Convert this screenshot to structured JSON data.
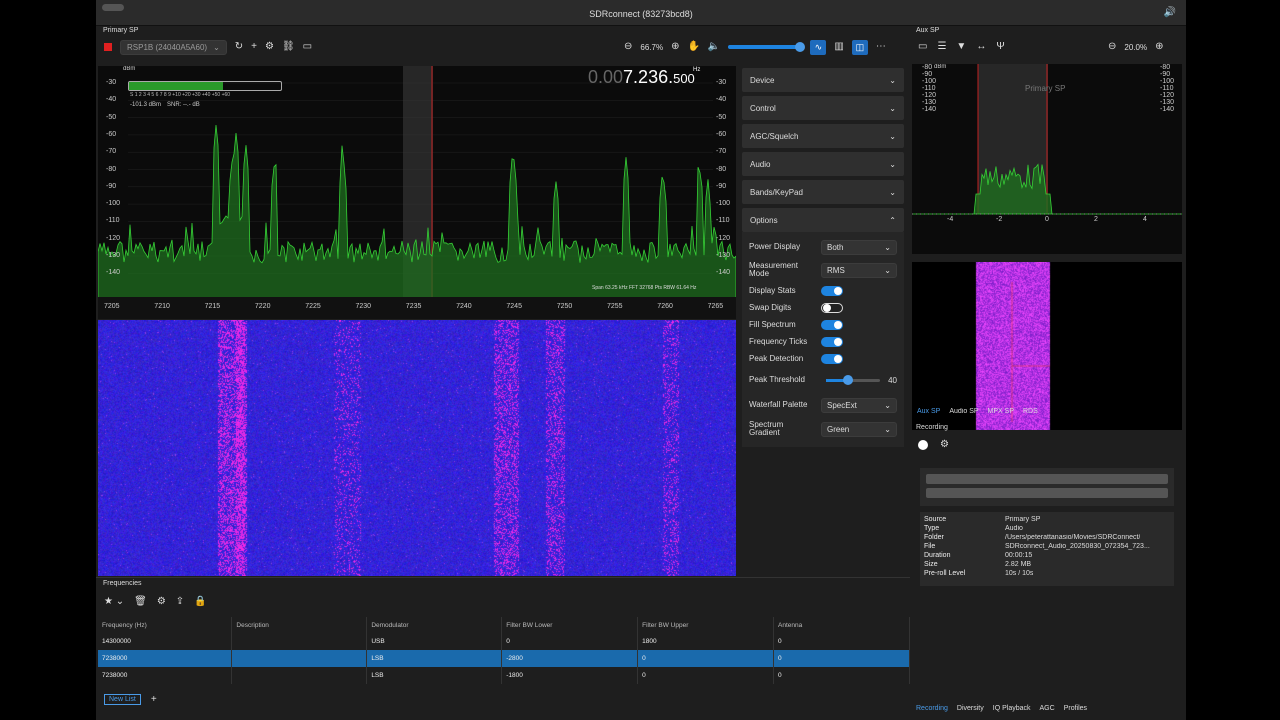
{
  "app": {
    "title": "SDRconnect (83273bcd8)"
  },
  "primary": {
    "panel_title": "Primary SP",
    "device_select": "RSP1B (24040A5A60)",
    "zoom": "66.7%",
    "frequency_dim": "0.00",
    "frequency_main": "7.236.",
    "frequency_small": "500",
    "frequency_unit": "Hz",
    "smeter": {
      "unit": "dBm",
      "scale": "S 1 2 3 4 5 6 7 8 9 +10 +20 +30 +40 +50 +60",
      "level": "-101.3 dBm",
      "snr": "SNR: --.- dB",
      "fill": 0.62
    },
    "y_ticks": [
      "-30",
      "-40",
      "-50",
      "-60",
      "-70",
      "-80",
      "-90",
      "-100",
      "-110",
      "-120",
      "-130",
      "-140"
    ],
    "x_ticks": [
      "7205",
      "7210",
      "7215",
      "7220",
      "7225",
      "7230",
      "7235",
      "7240",
      "7245",
      "7250",
      "7255",
      "7260",
      "7265"
    ],
    "span_info": "Span 63.25 kHz FFT 32768 Pts RBW 61.64 Hz"
  },
  "sidebar": {
    "sections": [
      "Device",
      "Control",
      "AGC/Squelch",
      "Audio",
      "Bands/KeyPad",
      "Options"
    ],
    "options": {
      "power_display": {
        "label": "Power Display",
        "value": "Both"
      },
      "measurement_mode": {
        "label": "Measurement Mode",
        "value": "RMS"
      },
      "toggles": [
        {
          "label": "Display Stats",
          "on": true
        },
        {
          "label": "Swap Digits",
          "on": false
        },
        {
          "label": "Fill Spectrum",
          "on": true
        },
        {
          "label": "Frequency Ticks",
          "on": true
        },
        {
          "label": "Peak Detection",
          "on": true
        }
      ],
      "peak_threshold": {
        "label": "Peak Threshold",
        "value": "40",
        "fraction": 0.4
      },
      "waterfall_palette": {
        "label": "Waterfall Palette",
        "value": "SpecExt"
      },
      "spectrum_gradient": {
        "label": "Spectrum Gradient",
        "value": "Green"
      }
    }
  },
  "frequencies": {
    "panel_title": "Frequencies",
    "columns": [
      "Frequency (Hz)",
      "Description",
      "Demodulator",
      "Filter BW Lower",
      "Filter BW Upper",
      "Antenna"
    ],
    "rows": [
      [
        "14300000",
        "",
        "USB",
        "0",
        "1800",
        "0"
      ],
      [
        "7238000",
        "",
        "LSB",
        "-2800",
        "0",
        "0"
      ],
      [
        "7238000",
        "",
        "LSB",
        "-1800",
        "0",
        "0"
      ]
    ],
    "list_tab": "New List"
  },
  "aux": {
    "panel_title": "Aux SP",
    "zoom": "20.0%",
    "unit": "dBm",
    "overlay_label": "Primary SP",
    "y_ticks": [
      "-80",
      "-90",
      "-100",
      "-110",
      "-120",
      "-130",
      "-140"
    ],
    "x_ticks": [
      "-4",
      "-2",
      "0",
      "2",
      "4"
    ],
    "tabs": [
      "Aux SP",
      "Audio SP",
      "MPX SP",
      "RDS"
    ]
  },
  "recording": {
    "panel_title": "Recording",
    "info": [
      [
        "Source",
        "Primary SP"
      ],
      [
        "Type",
        "Audio"
      ],
      [
        "Folder",
        "/Users/peterattanasio/Movies/SDRConnect/"
      ],
      [
        "File",
        "SDRconnect_Audio_20250830_072354_723..."
      ],
      [
        "Duration",
        "00:00:15"
      ],
      [
        "Size",
        "2.82 MB"
      ],
      [
        "Pre-roll Level",
        "10s / 10s"
      ]
    ],
    "bottom_tabs": [
      "Recording",
      "Diversity",
      "IQ Playback",
      "AGC",
      "Profiles"
    ]
  }
}
